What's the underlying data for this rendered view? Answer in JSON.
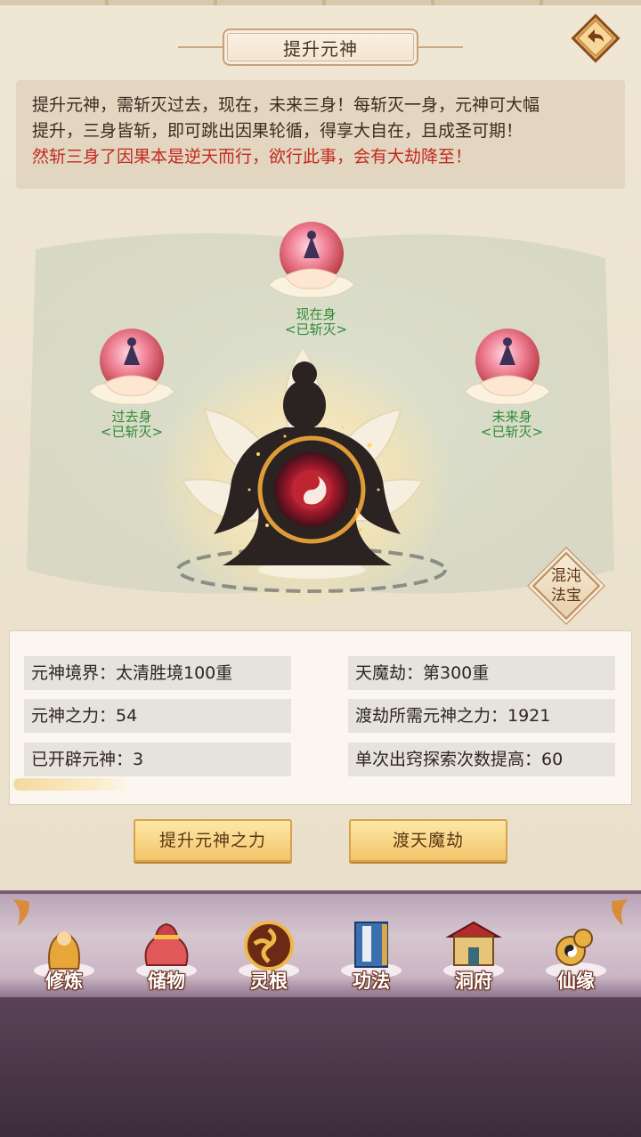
{
  "header": {
    "title": "提升元神",
    "back_icon": "back-arrow-icon"
  },
  "description": {
    "line1": "提升元神，需斩灭过去，现在，未来三身！每斩灭一身，元神可大幅",
    "line2": "提升，三身皆斩，即可跳出因果轮循，得享大自在，且成圣可期！",
    "warning": "然斩三身了因果本是逆天而行，欲行此事，会有大劫降至！"
  },
  "bodies": {
    "present": {
      "name": "现在身",
      "status": "<已斩灭>"
    },
    "past": {
      "name": "过去身",
      "status": "<已斩灭>"
    },
    "future": {
      "name": "未来身",
      "status": "<已斩灭>"
    }
  },
  "side_button": {
    "line1": "混沌",
    "line2": "法宝"
  },
  "stats": {
    "realm": "元神境界：太清胜境100重",
    "power": "元神之力：54",
    "opened": "已开辟元神：3",
    "tribulation": "天魔劫：第300重",
    "required": "渡劫所需元神之力：1921",
    "explore": "单次出窍探索次数提高：60"
  },
  "actions": {
    "raise": "提升元神之力",
    "cross": "渡天魔劫"
  },
  "nav": [
    {
      "label": "修炼",
      "icon": "cultivation-icon"
    },
    {
      "label": "储物",
      "icon": "storage-bag-icon"
    },
    {
      "label": "灵根",
      "icon": "spirit-root-icon"
    },
    {
      "label": "功法",
      "icon": "scripture-book-icon"
    },
    {
      "label": "洞府",
      "icon": "cave-mansion-icon"
    },
    {
      "label": "仙缘",
      "icon": "immortal-fate-icon"
    }
  ],
  "colors": {
    "warning": "#c4291f",
    "status_green": "#2f8a36",
    "button_gold": "#f3c56a"
  }
}
